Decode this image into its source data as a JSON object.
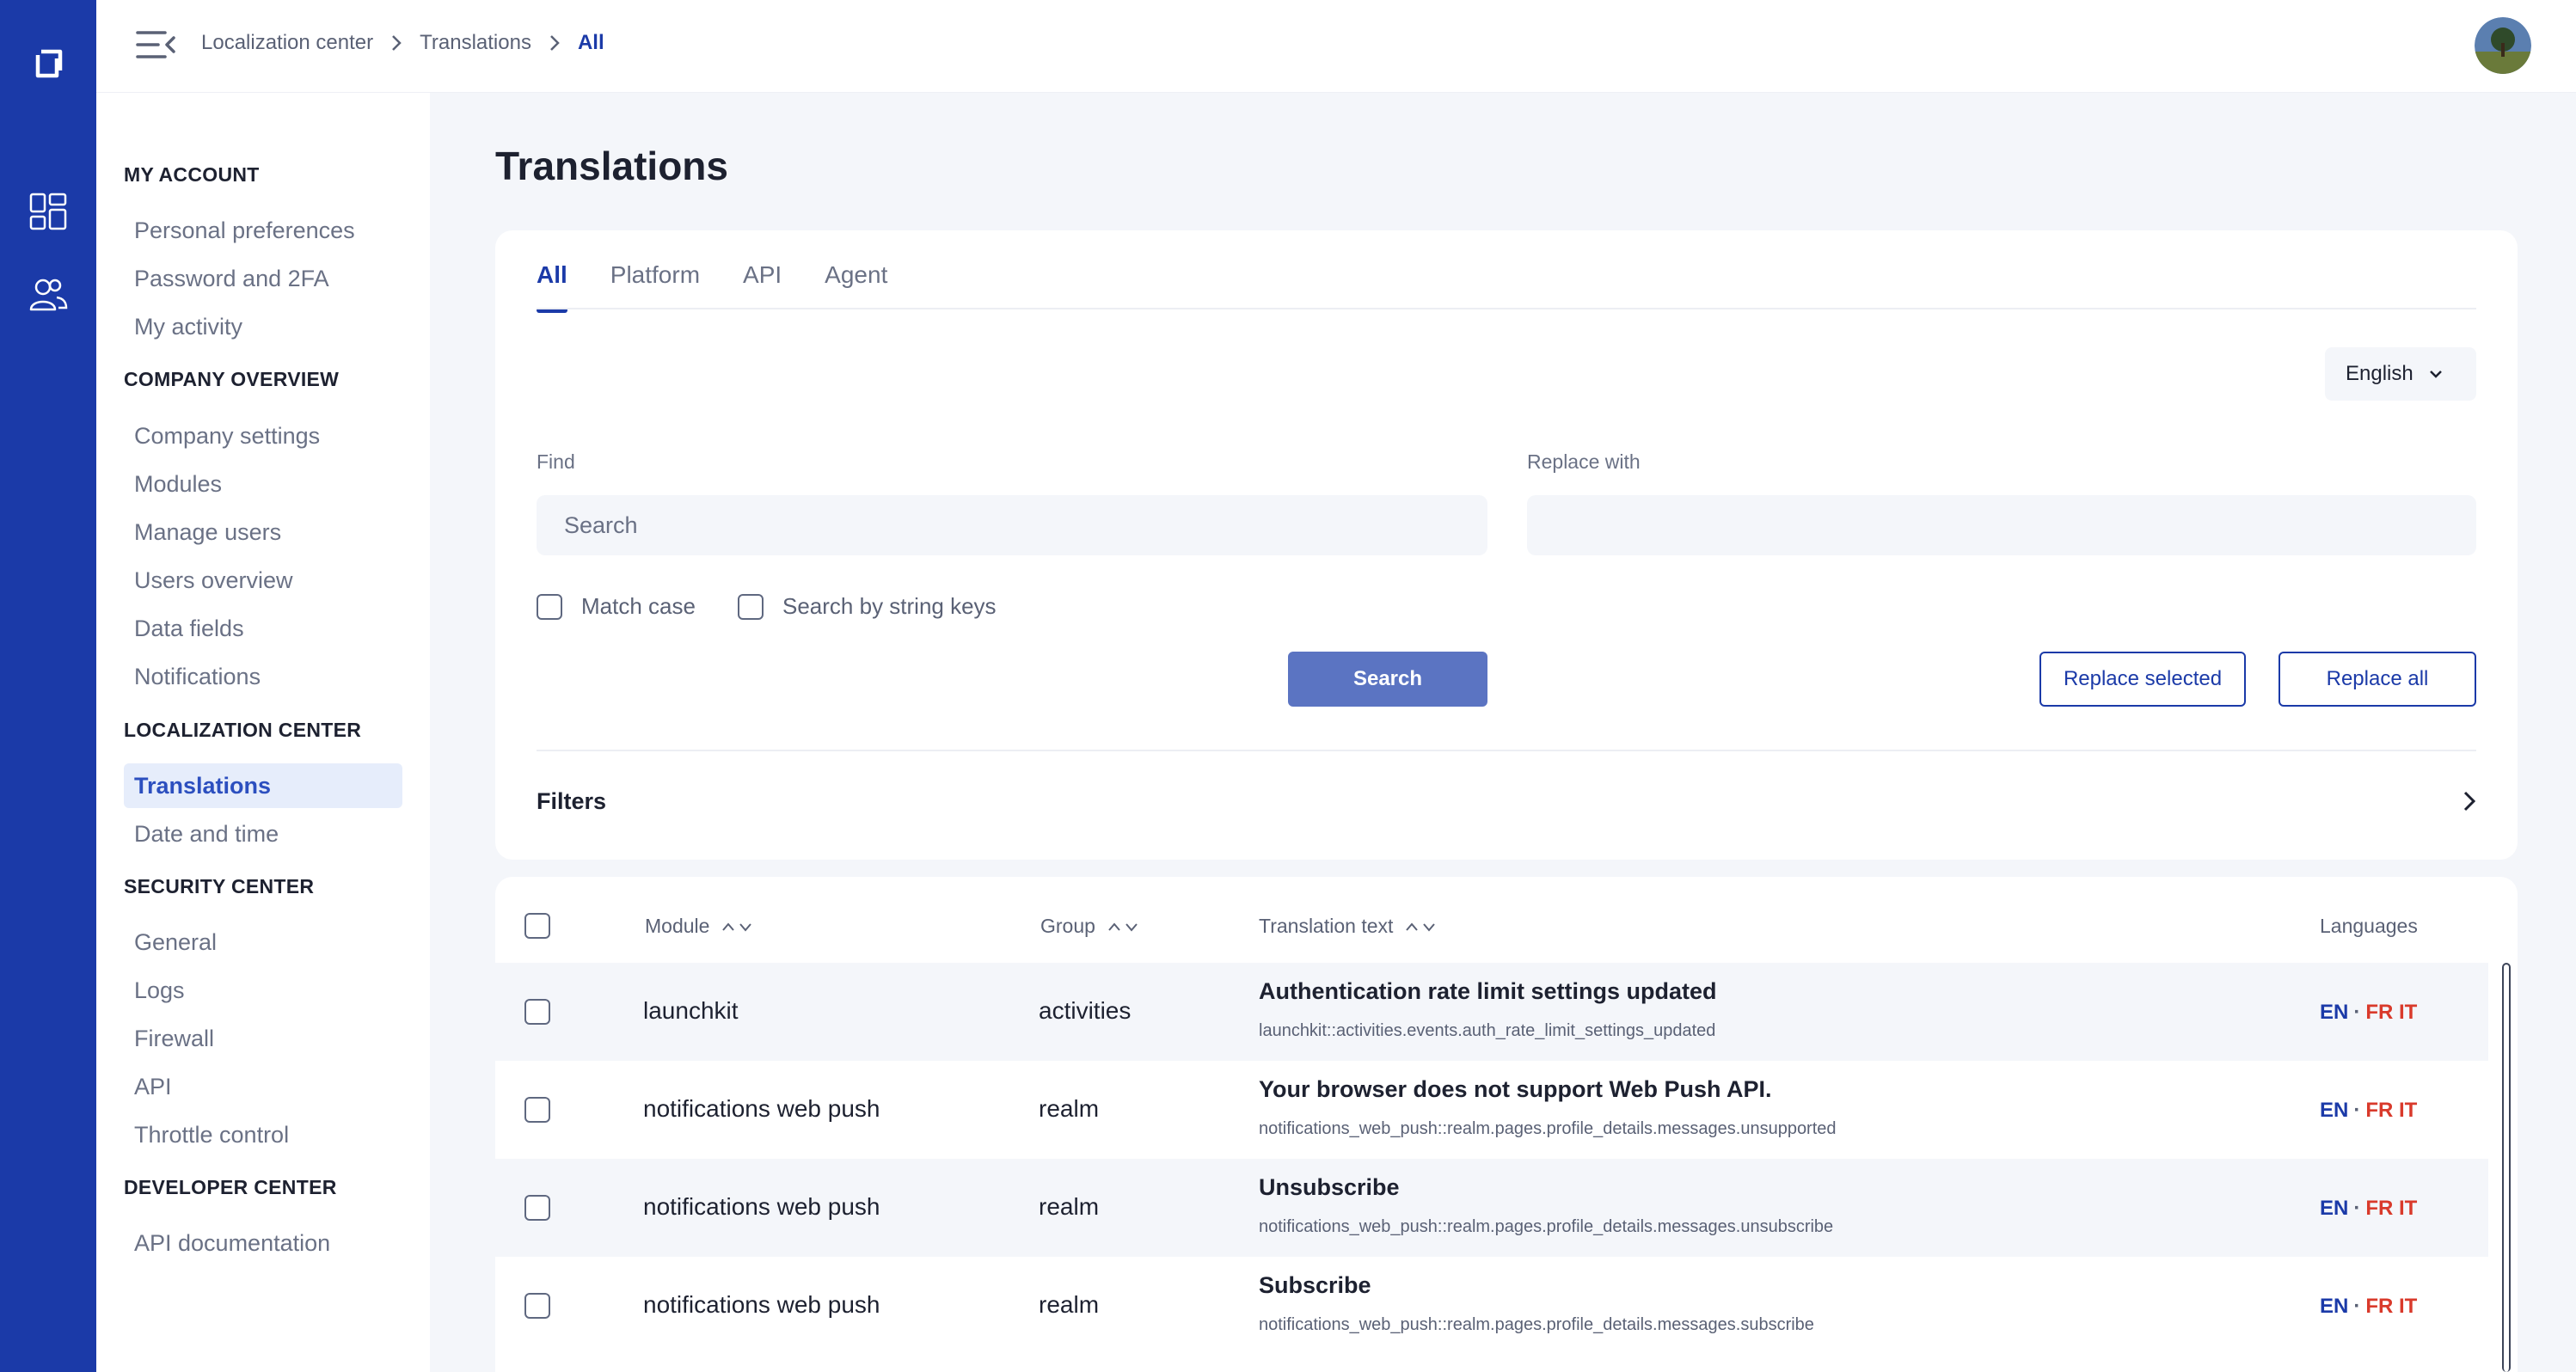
{
  "breadcrumb": {
    "items": [
      "Localization center",
      "Translations",
      "All"
    ]
  },
  "sidebar": {
    "sections": [
      {
        "title": "MY ACCOUNT",
        "items": [
          "Personal preferences",
          "Password and 2FA",
          "My activity"
        ]
      },
      {
        "title": "COMPANY OVERVIEW",
        "items": [
          "Company settings",
          "Modules",
          "Manage users",
          "Users overview",
          "Data fields",
          "Notifications"
        ]
      },
      {
        "title": "LOCALIZATION CENTER",
        "items": [
          "Translations",
          "Date and time"
        ]
      },
      {
        "title": "SECURITY CENTER",
        "items": [
          "General",
          "Logs",
          "Firewall",
          "API",
          "Throttle control"
        ]
      },
      {
        "title": "DEVELOPER CENTER",
        "items": [
          "API documentation"
        ]
      }
    ],
    "active_item": "Translations"
  },
  "page": {
    "title": "Translations"
  },
  "tabs": [
    "All",
    "Platform",
    "API",
    "Agent"
  ],
  "active_tab": "All",
  "language_select": {
    "value": "English"
  },
  "find": {
    "label": "Find",
    "placeholder": "Search",
    "value": ""
  },
  "replace": {
    "label": "Replace with",
    "placeholder": "",
    "value": ""
  },
  "options": {
    "match_case": "Match case",
    "search_by_keys": "Search by string keys"
  },
  "buttons": {
    "search": "Search",
    "replace_selected": "Replace selected",
    "replace_all": "Replace all"
  },
  "filters": {
    "label": "Filters"
  },
  "table": {
    "columns": {
      "module": "Module",
      "group": "Group",
      "translation": "Translation text",
      "languages": "Languages"
    },
    "rows": [
      {
        "module": "launchkit",
        "group": "activities",
        "title": "Authentication rate limit settings updated",
        "key": "launchkit::activities.events.auth_rate_limit_settings_updated",
        "langs": [
          "EN",
          "FR",
          "IT"
        ]
      },
      {
        "module": "notifications web push",
        "group": "realm",
        "title": "Your browser does not support Web Push API.",
        "key": "notifications_web_push::realm.pages.profile_details.messages.unsupported",
        "langs": [
          "EN",
          "FR",
          "IT"
        ]
      },
      {
        "module": "notifications web push",
        "group": "realm",
        "title": "Unsubscribe",
        "key": "notifications_web_push::realm.pages.profile_details.messages.unsubscribe",
        "langs": [
          "EN",
          "FR",
          "IT"
        ]
      },
      {
        "module": "notifications web push",
        "group": "realm",
        "title": "Subscribe",
        "key": "notifications_web_push::realm.pages.profile_details.messages.subscribe",
        "langs": [
          "EN",
          "FR",
          "IT"
        ]
      }
    ]
  },
  "icons": {
    "rail_logo": "app-logo-icon",
    "rail_dashboard": "dashboard-grid-icon",
    "rail_users": "users-icon",
    "menu": "menu-collapse-icon",
    "avatar": "user-avatar"
  },
  "colors": {
    "brand": "#1b3aa8",
    "primary_button": "#5b74c2",
    "lang_secondary": "#d93a2b"
  }
}
